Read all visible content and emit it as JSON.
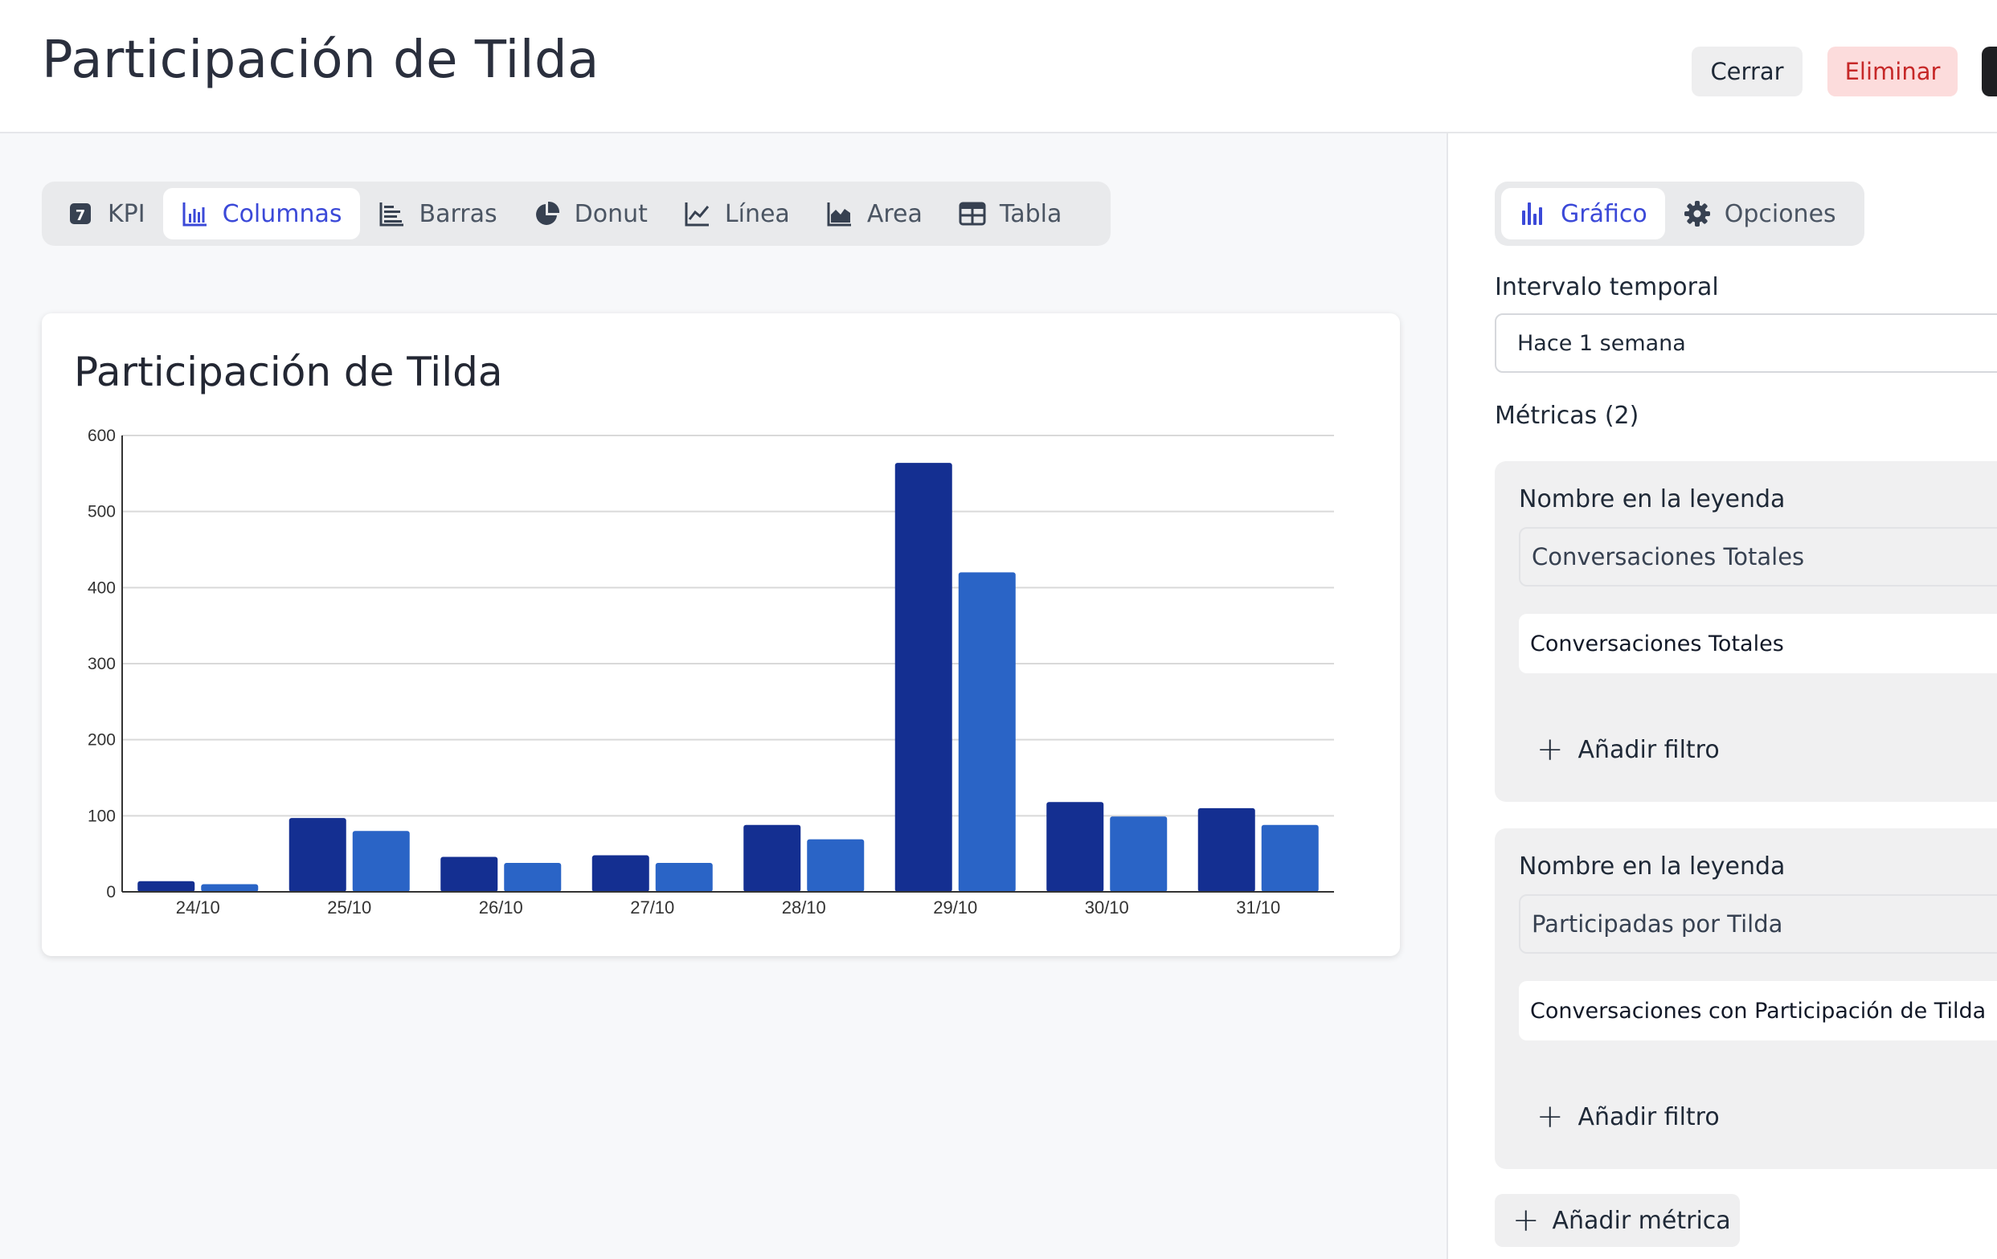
{
  "header": {
    "title": "Participación de Tilda",
    "close_label": "Cerrar",
    "delete_label": "Eliminar"
  },
  "chart_types": [
    {
      "label": "KPI",
      "icon": "number-seven-icon",
      "active": false
    },
    {
      "label": "Columnas",
      "icon": "column-chart-icon",
      "active": true
    },
    {
      "label": "Barras",
      "icon": "bar-chart-icon",
      "active": false
    },
    {
      "label": "Donut",
      "icon": "pie-chart-icon",
      "active": false
    },
    {
      "label": "Línea",
      "icon": "line-chart-icon",
      "active": false
    },
    {
      "label": "Area",
      "icon": "area-chart-icon",
      "active": false
    },
    {
      "label": "Tabla",
      "icon": "table-icon",
      "active": false
    }
  ],
  "card": {
    "title": "Participación de Tilda"
  },
  "chart_data": {
    "type": "bar",
    "categories": [
      "24/10",
      "25/10",
      "26/10",
      "27/10",
      "28/10",
      "29/10",
      "30/10",
      "31/10"
    ],
    "series": [
      {
        "values": [
          14,
          97,
          46,
          48,
          88,
          564,
          118,
          110
        ],
        "color": "#142f91"
      },
      {
        "values": [
          10,
          80,
          38,
          38,
          69,
          420,
          99,
          88
        ],
        "color": "#2a64c6"
      }
    ],
    "ylim": [
      0,
      600
    ],
    "yticks": [
      "0",
      "100",
      "200",
      "300",
      "400",
      "500",
      "600"
    ],
    "grid": true
  },
  "side_tabs": {
    "chart_label": "Gráfico",
    "options_label": "Opciones"
  },
  "settings": {
    "interval_label": "Intervalo temporal",
    "interval_value": "Hace 1 semana",
    "metrics_label": "Métricas (2)",
    "legend_label": "Nombre en la leyenda",
    "add_filter_label": "Añadir filtro",
    "add_metric_label": "Añadir métrica",
    "metrics": [
      {
        "legend_name": "Conversaciones Totales",
        "metric": "Conversaciones Totales"
      },
      {
        "legend_name": "Participadas por Tilda",
        "metric": "Conversaciones con Participación de Tilda"
      }
    ]
  },
  "colors": {
    "accent": "#3b49d8",
    "series_dark": "#142f91",
    "series_light": "#2a64c6",
    "danger": "#c62828"
  }
}
